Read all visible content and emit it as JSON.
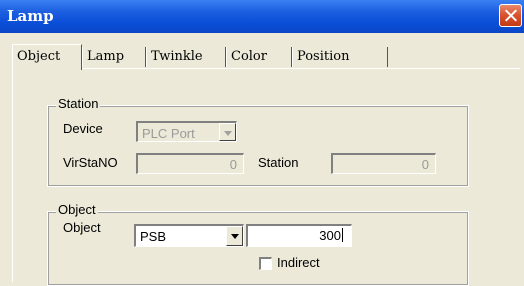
{
  "window": {
    "title": "Lamp"
  },
  "tabs": [
    "Object",
    "Lamp",
    "Twinkle",
    "Color",
    "Position"
  ],
  "station": {
    "legend": "Station",
    "device_label": "Device",
    "device_value": "PLC Port",
    "virstano_label": "VirStaNO",
    "virstano_value": "0",
    "station_label": "Station",
    "station_value": "0"
  },
  "object": {
    "legend": "Object",
    "object_label": "Object",
    "object_type": "PSB",
    "object_address": "300",
    "indirect_label": "Indirect",
    "indirect_checked": false
  }
}
